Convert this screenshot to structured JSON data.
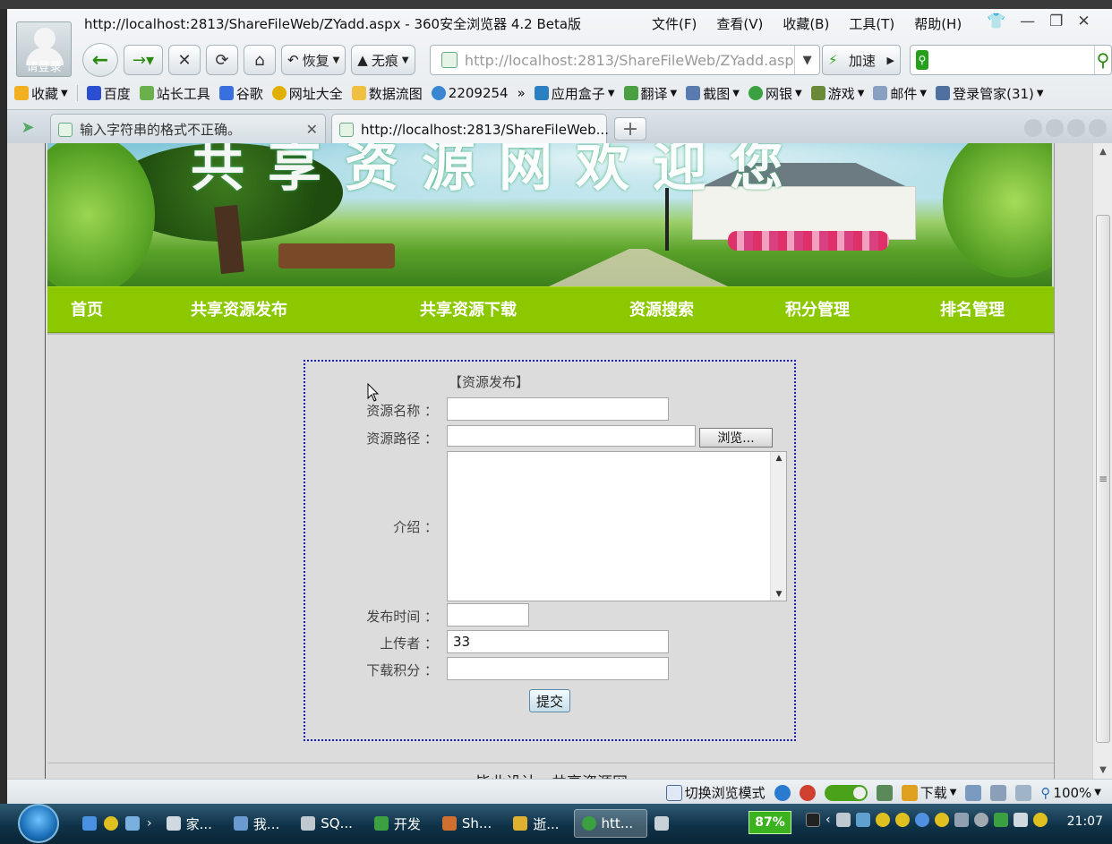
{
  "window": {
    "title": "http://localhost:2813/ShareFileWeb/ZYadd.aspx - 360安全浏览器 4.2 Beta版",
    "avatar_label": "请登录",
    "menu": [
      "文件(F)",
      "查看(V)",
      "收藏(B)",
      "工具(T)",
      "帮助(H)"
    ],
    "controls": [
      "👕",
      "—",
      "❐",
      "✕"
    ]
  },
  "toolbar": {
    "restore_label": "恢复",
    "incognito_label": "无痕",
    "url": "http://localhost:2813/ShareFileWeb/ZYadd.aspx",
    "speed_label": "加速",
    "search_placeholder": ""
  },
  "bookmarks": {
    "items": [
      "收藏",
      "百度",
      "站长工具",
      "谷歌",
      "网址大全",
      "数据流图",
      "2209254",
      "»",
      "应用盒子",
      "翻译",
      "截图",
      "网银",
      "游戏",
      "邮件",
      "登录管家(31)"
    ]
  },
  "tabs": [
    {
      "label": "输入字符串的格式不正确。",
      "active": false
    },
    {
      "label": "http://localhost:2813/ShareFileWeb...",
      "active": true
    }
  ],
  "site": {
    "banner_title": "共享资源网欢迎您",
    "nav": [
      "首页",
      "共享资源发布",
      "共享资源下载",
      "资源搜索",
      "积分管理",
      "排名管理"
    ],
    "footer": "毕业设计－共享资源网"
  },
  "form": {
    "title": "【资源发布】",
    "fields": {
      "name_label": "资源名称 ：",
      "path_label": "资源路径 ：",
      "intro_label": "介绍 ：",
      "time_label": "发布时间 ：",
      "uploader_label": "上传者 ：",
      "points_label": "下载积分 ："
    },
    "values": {
      "name": "",
      "path": "",
      "intro": "",
      "time": "",
      "uploader": "33",
      "points": ""
    },
    "browse_label": "浏览...",
    "submit_label": "提交"
  },
  "statusbar": {
    "mode_label": "切换浏览模式",
    "download_label": "下载",
    "zoom": "100%"
  },
  "taskbar": {
    "tasks": [
      "家...",
      "我...",
      "SQ...",
      "开发",
      "Sh...",
      "逝...",
      "htt..."
    ],
    "battery": "87%",
    "clock": "21:07"
  },
  "colors": {
    "nav_green": "#8cc800",
    "form_border": "#1a1ad0",
    "page_bg": "#dcdcdc"
  }
}
